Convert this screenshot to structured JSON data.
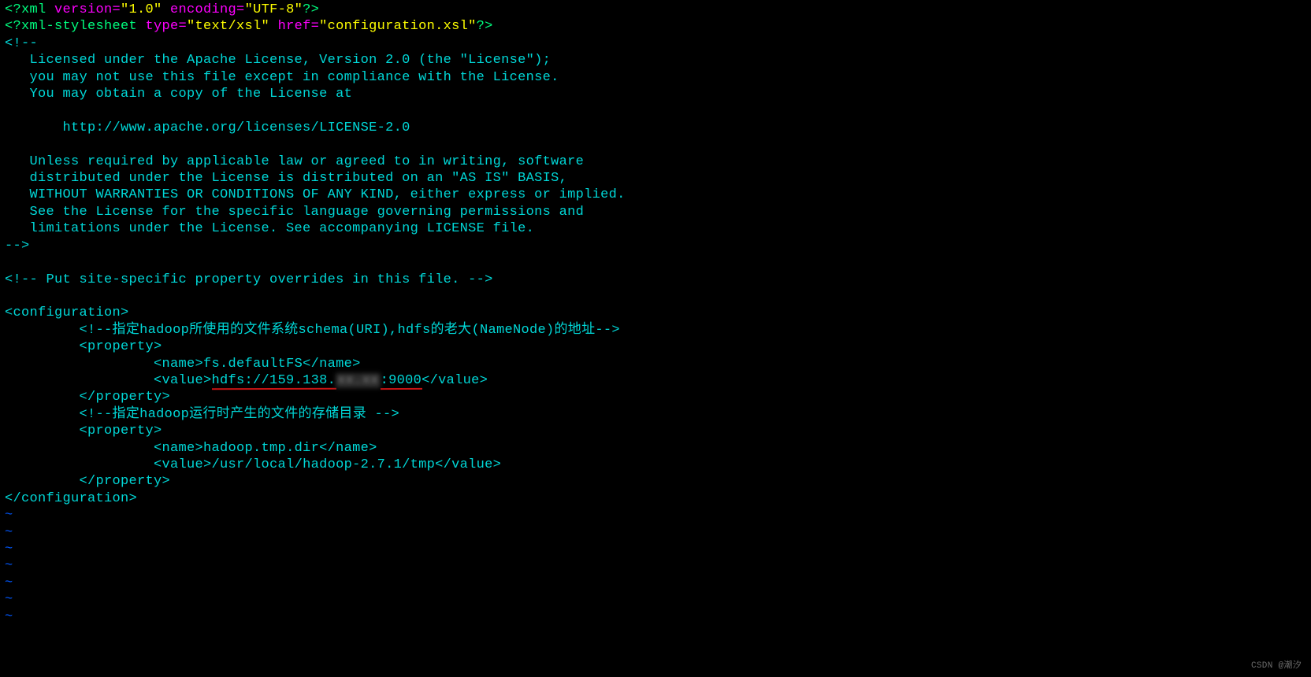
{
  "line0": {
    "a": "<?xml ",
    "b": "version=",
    "c": "\"1.0\"",
    "d": " encoding=",
    "e": "\"UTF-8\"",
    "f": "?>"
  },
  "line1": {
    "a": "<?xml-stylesheet ",
    "b": "type=",
    "c": "\"text/xsl\"",
    "d": " href=",
    "e": "\"configuration.xsl\"",
    "f": "?>"
  },
  "line2": "<!--",
  "line3": "   Licensed under the Apache License, Version 2.0 (the \"License\");",
  "line4": "   you may not use this file except in compliance with the License.",
  "line5": "   You may obtain a copy of the License at",
  "line6": "",
  "line7": "       http://www.apache.org/licenses/LICENSE-2.0",
  "line8": "",
  "line9": "   Unless required by applicable law or agreed to in writing, software",
  "line10": "   distributed under the License is distributed on an \"AS IS\" BASIS,",
  "line11": "   WITHOUT WARRANTIES OR CONDITIONS OF ANY KIND, either express or implied.",
  "line12": "   See the License for the specific language governing permissions and",
  "line13": "   limitations under the License. See accompanying LICENSE file.",
  "line14": "-->",
  "line15": "",
  "line16": "<!-- Put site-specific property overrides in this file. -->",
  "line17": "",
  "line18": "<configuration>",
  "line19": "         <!--指定hadoop所使用的文件系统schema(URI),hdfs的老大(NameNode)的地址-->",
  "line20": "         <property>",
  "line21a": "                  <name>",
  "line21b": "fs.defaultFS",
  "line21c": "</name>",
  "line22a": "                  <value>",
  "line22b": "hdfs://159.138.",
  "line22mask": "xx.xx",
  "line22c": ":9000",
  "line22d": "</value>",
  "line23": "         </property>",
  "line24": "         <!--指定hadoop运行时产生的文件的存储目录 -->",
  "line25": "         <property>",
  "line26a": "                  <name>",
  "line26b": "hadoop.tmp.dir",
  "line26c": "</name>",
  "line27a": "                  <value>",
  "line27b": "/usr/local/hadoop-2.7.1/tmp",
  "line27c": "</value>",
  "line28": "         </property>",
  "line29": "</configuration>",
  "tilde": "~",
  "watermark": "CSDN @潮汐"
}
